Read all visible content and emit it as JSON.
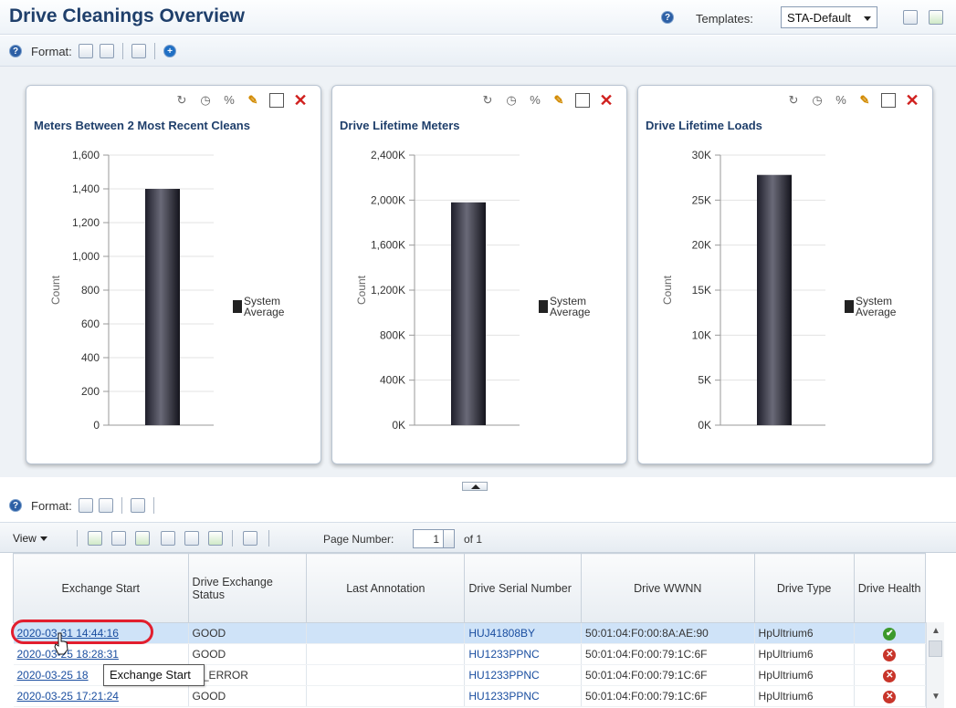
{
  "header": {
    "title": "Drive Cleanings Overview",
    "templates_label": "Templates:",
    "template_selected": "STA-Default"
  },
  "format_bar": {
    "label": "Format:"
  },
  "charts": [
    {
      "title": "Meters Between 2 Most Recent Cleans",
      "axis_label": "Count",
      "legend": [
        "System",
        "Average"
      ]
    },
    {
      "title": "Drive Lifetime Meters",
      "axis_label": "Count",
      "legend": [
        "System",
        "Average"
      ]
    },
    {
      "title": "Drive Lifetime Loads",
      "axis_label": "Count",
      "legend": [
        "System",
        "Average"
      ]
    }
  ],
  "chart_data": [
    {
      "type": "bar",
      "title": "Meters Between 2 Most Recent Cleans",
      "ylabel": "Count",
      "yticks": [
        "0",
        "200",
        "400",
        "600",
        "800",
        "1,000",
        "1,200",
        "1,400",
        "1,600"
      ],
      "ylim": [
        0,
        1600
      ],
      "series": [
        {
          "name": "System Average",
          "values": [
            1400
          ]
        }
      ],
      "legend": "right"
    },
    {
      "type": "bar",
      "title": "Drive Lifetime Meters",
      "ylabel": "Count",
      "yticks": [
        "0K",
        "400K",
        "800K",
        "1,200K",
        "1,600K",
        "2,000K",
        "2,400K"
      ],
      "ylim": [
        0,
        2400
      ],
      "series": [
        {
          "name": "System Average",
          "values": [
            1980
          ]
        }
      ],
      "legend": "right"
    },
    {
      "type": "bar",
      "title": "Drive Lifetime Loads",
      "ylabel": "Count",
      "yticks": [
        "0K",
        "5K",
        "10K",
        "15K",
        "20K",
        "25K",
        "30K"
      ],
      "ylim": [
        0,
        30
      ],
      "series": [
        {
          "name": "System Average",
          "values": [
            27.8
          ]
        }
      ],
      "legend": "right"
    }
  ],
  "table_format": {
    "label": "Format:"
  },
  "table_toolbar": {
    "view_label": "View",
    "page_label": "Page Number:",
    "page_value": "1",
    "page_of": "of 1"
  },
  "table": {
    "columns": [
      "Exchange Start",
      "Drive Exchange Status",
      "Last Annotation",
      "Drive Serial Number",
      "Drive WWNN",
      "Drive Type",
      "Drive Health"
    ],
    "rows": [
      {
        "start": "2020-03-31 14:44:16",
        "status": "GOOD",
        "annotation": "",
        "serial": "HUJ41808BY",
        "wwnn": "50:01:04:F0:00:8A:AE:90",
        "type": "HpUltrium6",
        "health": "good"
      },
      {
        "start": "2020-03-25 18:28:31",
        "status": "GOOD",
        "annotation": "",
        "serial": "HU1233PPNC",
        "wwnn": "50:01:04:F0:00:79:1C:6F",
        "type": "HpUltrium6",
        "health": "bad"
      },
      {
        "start": "2020-03-25 18",
        "status": "IA_ERROR",
        "annotation": "",
        "serial": "HU1233PPNC",
        "wwnn": "50:01:04:F0:00:79:1C:6F",
        "type": "HpUltrium6",
        "health": "bad"
      },
      {
        "start": "2020-03-25 17:21:24",
        "status": "GOOD",
        "annotation": "",
        "serial": "HU1233PPNC",
        "wwnn": "50:01:04:F0:00:79:1C:6F",
        "type": "HpUltrium6",
        "health": "bad"
      }
    ]
  },
  "tooltip": "Exchange Start",
  "colors": {
    "title": "#1f3f6b",
    "link": "#1a4ea0",
    "selected_row": "#cfe3f8",
    "highlight": "#e21e2e",
    "good": "#3c9a2c",
    "bad": "#c8352a"
  },
  "icons": [
    "help-icon",
    "print-icon",
    "add-icon",
    "edit-icon",
    "close-icon",
    "maximize-icon",
    "clock-icon",
    "refresh-icon",
    "filter-icon"
  ]
}
